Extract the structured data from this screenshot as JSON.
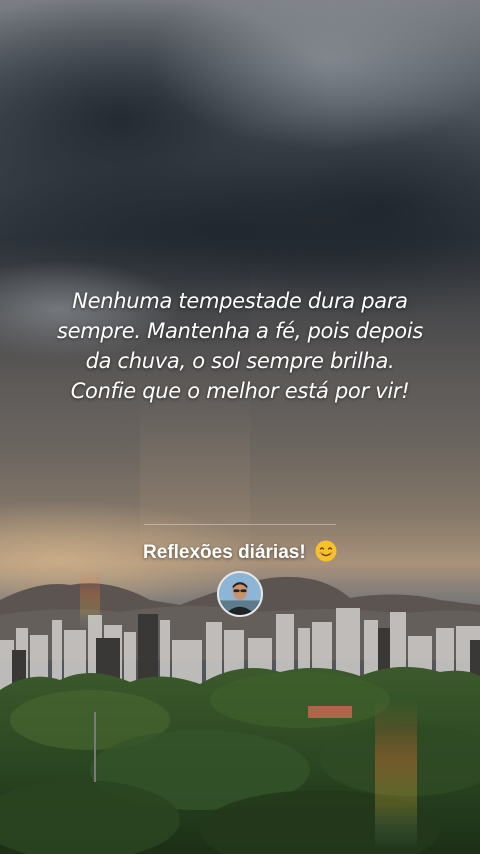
{
  "post": {
    "quote_lines": [
      "Nenhuma tempestade dura para",
      "sempre. Mantenha a fé, pois depois",
      "da chuva, o sol sempre brilha.",
      "Confie que o melhor está por vir!"
    ],
    "caption": "Reflexões diárias!",
    "caption_emoji": "smiling-face-emoji"
  },
  "author": {
    "avatar": "user-avatar"
  },
  "colors": {
    "text": "#ffffff",
    "sky_dark": "#3a4048",
    "sky_light": "#c9b59a",
    "foliage": "#2d4a22"
  }
}
